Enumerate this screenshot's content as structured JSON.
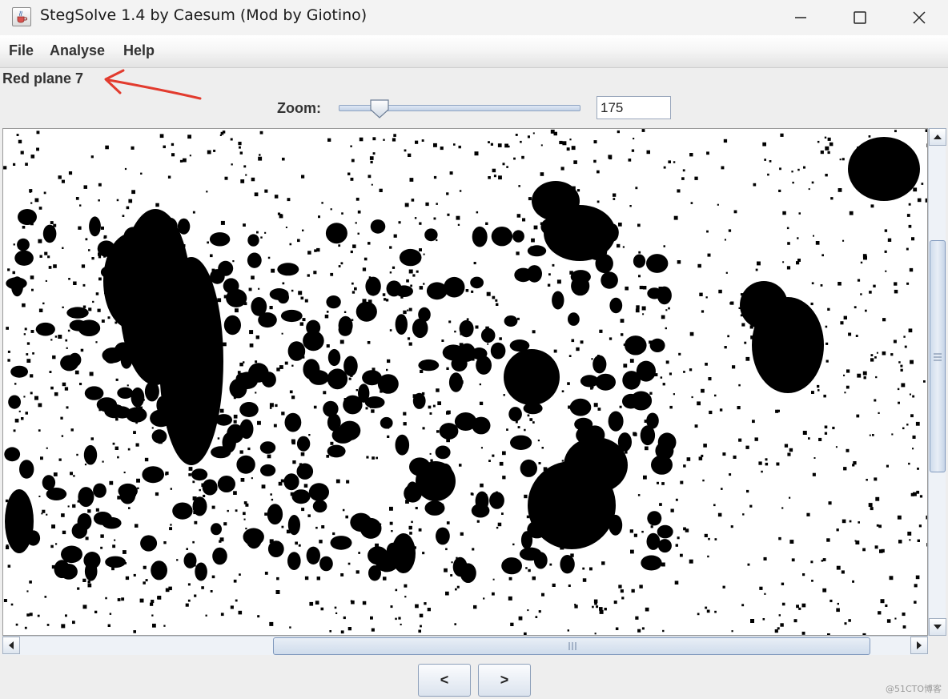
{
  "window": {
    "title": "StegSolve 1.4 by Caesum (Mod by Giotino)",
    "icon": "java-cup-icon",
    "controls": [
      "minimize-icon",
      "maximize-icon",
      "close-icon"
    ]
  },
  "menu": {
    "items": [
      {
        "label": "File"
      },
      {
        "label": "Analyse"
      },
      {
        "label": "Help"
      }
    ]
  },
  "view": {
    "plane_label": "Red plane 7",
    "annotation": {
      "icon": "red-arrow-icon",
      "color": "#e23b2e"
    }
  },
  "zoom": {
    "label": "Zoom:",
    "value": "175",
    "slider_fraction": 0.17
  },
  "image": {
    "description_icon": "bit-plane-image",
    "colors": {
      "foreground": "#000000",
      "background": "#ffffff"
    }
  },
  "scrollbars": {
    "vertical": {
      "position_fraction": 0.22,
      "visible_fraction": 0.46
    },
    "horizontal": {
      "position_fraction": 0.29,
      "visible_fraction": 0.66
    }
  },
  "navigation": {
    "prev_label": "<",
    "next_label": ">"
  },
  "watermark": "@51CTO博客"
}
